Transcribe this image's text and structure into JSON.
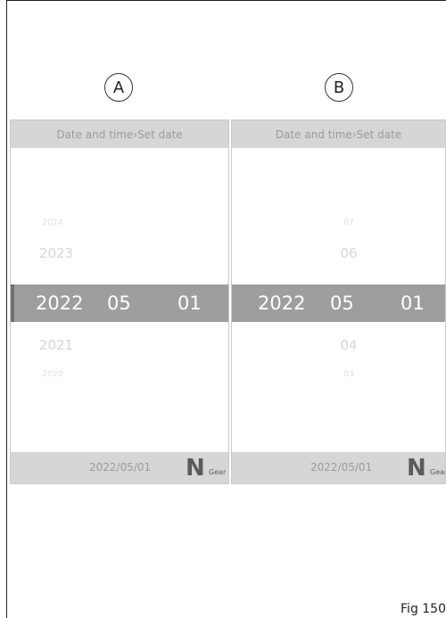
{
  "panel_a": {
    "label": "A",
    "header": "Date and time›Set date",
    "above_far": "2024",
    "above_near": "2023",
    "selected": {
      "year": "2022",
      "month": "05",
      "day": "01"
    },
    "below_near": "2021",
    "below_far": "2020",
    "footer_date": "2022/05/01",
    "gear_letter": "N",
    "gear_word": "Gear"
  },
  "panel_b": {
    "label": "B",
    "header": "Date and time›Set date",
    "above_far": "07",
    "above_near": "06",
    "selected": {
      "year": "2022",
      "month": "05",
      "day": "01"
    },
    "below_near": "04",
    "below_far": "03",
    "footer_date": "2022/05/01",
    "gear_letter": "N",
    "gear_word": "Gear"
  },
  "figure_caption": "Fig 150"
}
